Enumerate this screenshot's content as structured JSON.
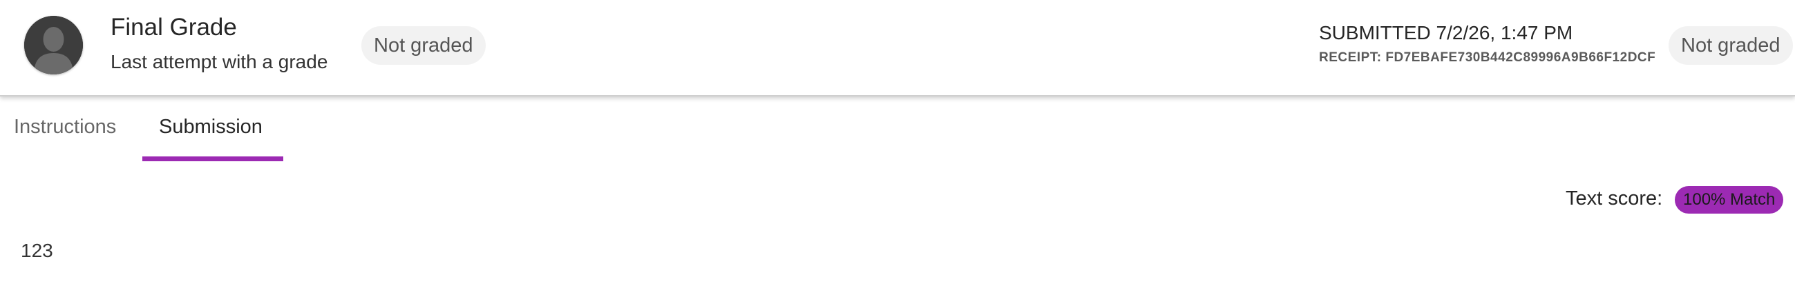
{
  "header": {
    "avatar_icon": "user-silhouette-icon",
    "title": "Final Grade",
    "subtitle": "Last attempt with a grade",
    "grade_status_left": "Not graded",
    "submitted": "SUBMITTED 7/2/26, 1:47 PM",
    "receipt": "RECEIPT: FD7EBAFE730B442C89996A9B66F12DCF",
    "grade_status_right": "Not graded"
  },
  "tabs": [
    {
      "label": "Instructions",
      "active": false
    },
    {
      "label": "Submission",
      "active": true
    }
  ],
  "submission": {
    "text_score_label": "Text score:",
    "text_score_value": "100% Match",
    "content": "123"
  },
  "colors": {
    "accent": "#9c2ab3",
    "pill_background": "#f2f2f2",
    "avatar_background": "#3d3d3d"
  }
}
